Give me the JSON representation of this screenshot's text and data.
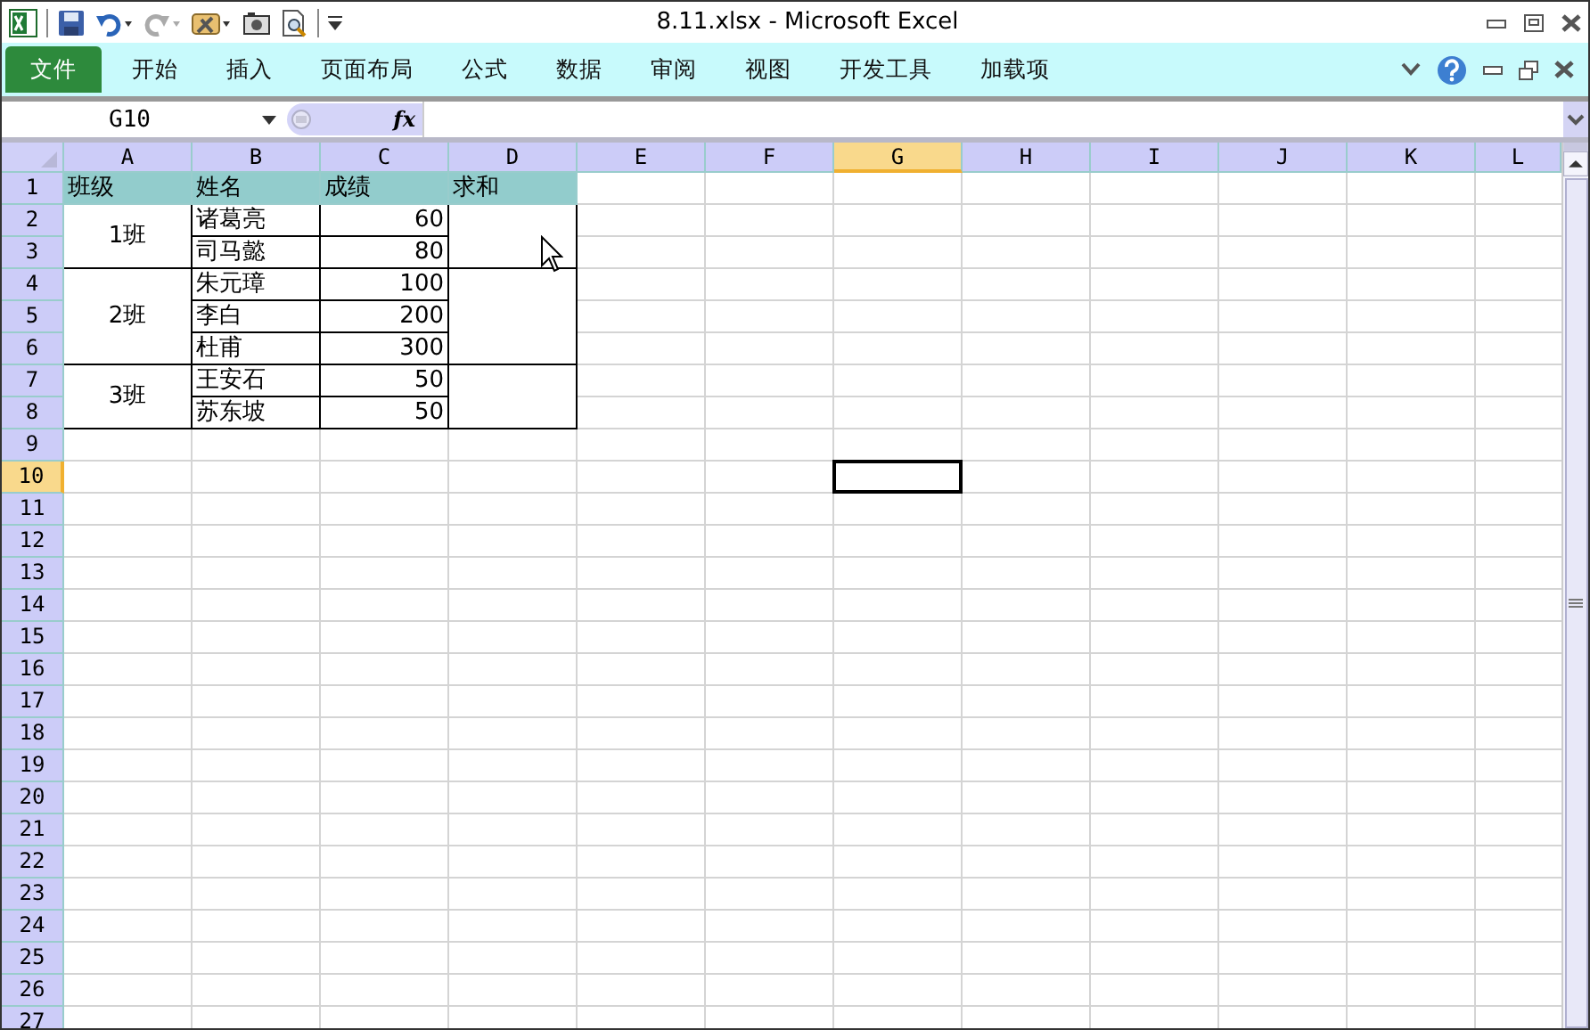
{
  "window": {
    "title": "8.11.xlsx  -  Microsoft Excel"
  },
  "ribbon": {
    "tabs": [
      {
        "label": "文件",
        "kind": "file",
        "selected": false
      },
      {
        "label": "开始",
        "kind": "tab",
        "selected": false
      },
      {
        "label": "插入",
        "kind": "tab",
        "selected": false
      },
      {
        "label": "页面布局",
        "kind": "tab",
        "selected": false
      },
      {
        "label": "公式",
        "kind": "tab",
        "selected": false
      },
      {
        "label": "数据",
        "kind": "tab",
        "selected": false
      },
      {
        "label": "审阅",
        "kind": "tab",
        "selected": false
      },
      {
        "label": "视图",
        "kind": "tab",
        "selected": false
      },
      {
        "label": "开发工具",
        "kind": "tab",
        "selected": false
      },
      {
        "label": "加载项",
        "kind": "tab",
        "selected": false
      }
    ]
  },
  "formula_bar": {
    "name_box": "G10",
    "function_label": "fx"
  },
  "sheet": {
    "columns": [
      {
        "label": "A",
        "selected": false
      },
      {
        "label": "B",
        "selected": false
      },
      {
        "label": "C",
        "selected": false
      },
      {
        "label": "D",
        "selected": false
      },
      {
        "label": "E",
        "selected": false
      },
      {
        "label": "F",
        "selected": false
      },
      {
        "label": "G",
        "selected": true
      },
      {
        "label": "H",
        "selected": false
      },
      {
        "label": "I",
        "selected": false
      },
      {
        "label": "J",
        "selected": false
      },
      {
        "label": "K",
        "selected": false
      },
      {
        "label": "L",
        "selected": false
      }
    ],
    "rows": [
      {
        "label": "1",
        "selected": false
      },
      {
        "label": "2",
        "selected": false
      },
      {
        "label": "3",
        "selected": false
      },
      {
        "label": "4",
        "selected": false
      },
      {
        "label": "5",
        "selected": false
      },
      {
        "label": "6",
        "selected": false
      },
      {
        "label": "7",
        "selected": false
      },
      {
        "label": "8",
        "selected": false
      },
      {
        "label": "9",
        "selected": false
      },
      {
        "label": "10",
        "selected": true
      },
      {
        "label": "11",
        "selected": false
      },
      {
        "label": "12",
        "selected": false
      },
      {
        "label": "13",
        "selected": false
      },
      {
        "label": "14",
        "selected": false
      },
      {
        "label": "15",
        "selected": false
      },
      {
        "label": "16",
        "selected": false
      },
      {
        "label": "17",
        "selected": false
      },
      {
        "label": "18",
        "selected": false
      },
      {
        "label": "19",
        "selected": false
      },
      {
        "label": "20",
        "selected": false
      },
      {
        "label": "21",
        "selected": false
      },
      {
        "label": "22",
        "selected": false
      },
      {
        "label": "23",
        "selected": false
      },
      {
        "label": "24",
        "selected": false
      },
      {
        "label": "25",
        "selected": false
      },
      {
        "label": "26",
        "selected": false
      },
      {
        "label": "27",
        "selected": false
      }
    ],
    "table": {
      "headers": [
        "班级",
        "姓名",
        "成绩",
        "求和"
      ],
      "groups": [
        {
          "class": "1班",
          "students": [
            {
              "name": "诸葛亮",
              "score": "60"
            },
            {
              "name": "司马懿",
              "score": "80"
            }
          ]
        },
        {
          "class": "2班",
          "students": [
            {
              "name": "朱元璋",
              "score": "100"
            },
            {
              "name": "李白",
              "score": "200"
            },
            {
              "name": "杜甫",
              "score": "300"
            }
          ]
        },
        {
          "class": "3班",
          "students": [
            {
              "name": "王安石",
              "score": "50"
            },
            {
              "name": "苏东坡",
              "score": "50"
            }
          ]
        }
      ]
    }
  }
}
